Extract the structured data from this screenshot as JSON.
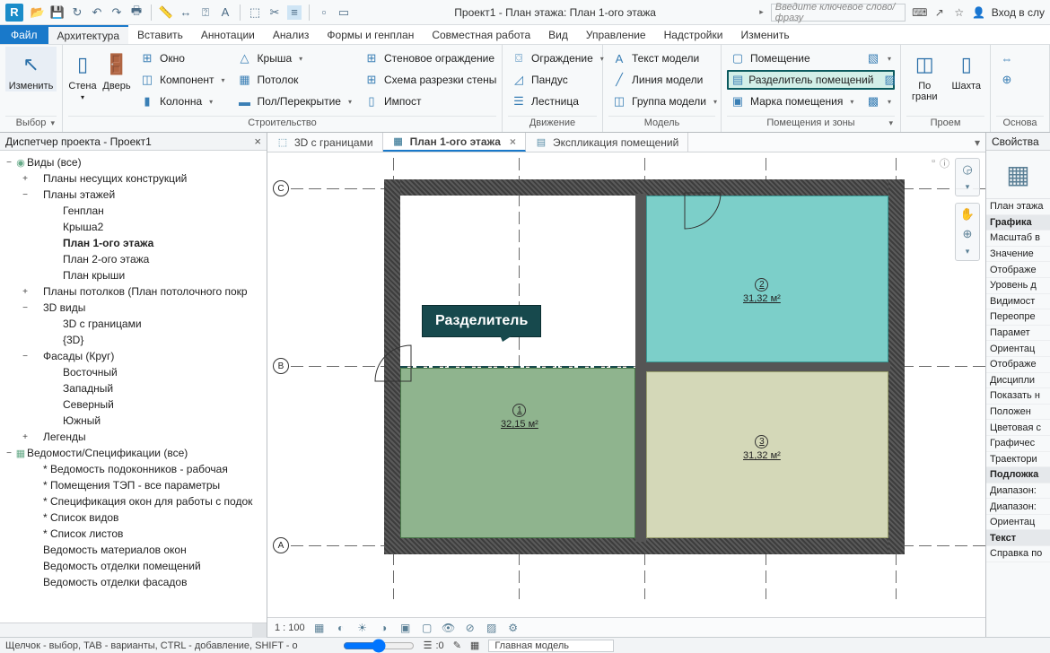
{
  "app_icon": "R",
  "title": "Проект1 - План этажа: План 1-ого этажа",
  "search_placeholder": "Введите ключевое слово/фразу",
  "signin": "Вход в слу",
  "file_tab": "Файл",
  "tabs": [
    "Архитектура",
    "Вставить",
    "Аннотации",
    "Анализ",
    "Формы и генплан",
    "Совместная работа",
    "Вид",
    "Управление",
    "Надстройки",
    "Изменить"
  ],
  "ribbon": {
    "select": {
      "big": "Изменить",
      "label": "Выбор"
    },
    "build": {
      "wall": "Стена",
      "door": "Дверь",
      "col1": [
        "Окно",
        "Компонент",
        "Колонна"
      ],
      "col2": [
        "Крыша",
        "Потолок",
        "Пол/Перекрытие"
      ],
      "col3": [
        "Стеновое ограждение",
        "Схема разрезки стены",
        "Импост"
      ],
      "label": "Строительство"
    },
    "circ": {
      "items": [
        "Ограждение",
        "Пандус",
        "Лестница"
      ],
      "label": "Движение"
    },
    "model": {
      "items": [
        "Текст модели",
        "Линия  модели",
        "Группа модели"
      ],
      "label": "Модель"
    },
    "room": {
      "items": [
        "Помещение",
        "Разделитель помещений",
        "Марка помещения"
      ],
      "label": "Помещения и зоны"
    },
    "opening": {
      "big1": "По грани",
      "big2": "Шахта",
      "label": "Проем"
    },
    "datum": {
      "label": "Основа"
    }
  },
  "browser": {
    "title": "Диспетчер проекта - Проект1",
    "nodes": [
      {
        "lvl": 0,
        "exp": "−",
        "icon": "◉",
        "label": "Виды (все)"
      },
      {
        "lvl": 1,
        "exp": "+",
        "label": "Планы несущих конструкций"
      },
      {
        "lvl": 1,
        "exp": "−",
        "label": "Планы этажей"
      },
      {
        "lvl": 2,
        "label": "Генплан"
      },
      {
        "lvl": 2,
        "label": "Крыша2"
      },
      {
        "lvl": 2,
        "label": "План 1-ого этажа",
        "bold": true
      },
      {
        "lvl": 2,
        "label": "План 2-ого этажа"
      },
      {
        "lvl": 2,
        "label": "План крыши"
      },
      {
        "lvl": 1,
        "exp": "+",
        "label": "Планы потолков (План потолочного покр"
      },
      {
        "lvl": 1,
        "exp": "−",
        "label": "3D виды"
      },
      {
        "lvl": 2,
        "label": "3D с границами"
      },
      {
        "lvl": 2,
        "label": "{3D}"
      },
      {
        "lvl": 1,
        "exp": "−",
        "label": "Фасады (Круг)"
      },
      {
        "lvl": 2,
        "label": "Восточный"
      },
      {
        "lvl": 2,
        "label": "Западный"
      },
      {
        "lvl": 2,
        "label": "Северный"
      },
      {
        "lvl": 2,
        "label": "Южный"
      },
      {
        "lvl": 1,
        "exp": "+",
        "label": "Легенды"
      },
      {
        "lvl": 0,
        "exp": "−",
        "icon": "▦",
        "label": "Ведомости/Спецификации (все)"
      },
      {
        "lvl": 1,
        "label": "* Ведомость подоконников - рабочая"
      },
      {
        "lvl": 1,
        "label": "* Помещения ТЭП - все параметры"
      },
      {
        "lvl": 1,
        "label": "* Спецификация окон для работы с подок"
      },
      {
        "lvl": 1,
        "label": "* Список видов"
      },
      {
        "lvl": 1,
        "label": "* Список листов"
      },
      {
        "lvl": 1,
        "label": "Ведомость материалов окон"
      },
      {
        "lvl": 1,
        "label": "Ведомость отделки помещений"
      },
      {
        "lvl": 1,
        "label": "Ведомость отделки фасадов"
      }
    ]
  },
  "viewtabs": [
    {
      "icon": "⬚",
      "label": "3D с границами"
    },
    {
      "icon": "▦",
      "label": "План 1-ого этажа",
      "active": true,
      "close": true
    },
    {
      "icon": "▤",
      "label": "Экспликация помещений"
    }
  ],
  "rooms": {
    "r1": {
      "num": "1",
      "area": "32,15 м²"
    },
    "r2": {
      "num": "2",
      "area": "31,32 м²"
    },
    "r3": {
      "num": "3",
      "area": "31,32 м²"
    }
  },
  "grids": {
    "h": [
      "C",
      "B",
      "A"
    ],
    "v": []
  },
  "callout": "Разделитель",
  "viewbar_scale": "1 : 100",
  "props": {
    "title": "Свойства",
    "type": "План этажа",
    "sections": [
      {
        "name": "Графика",
        "rows": [
          "Масштаб в",
          "Значение",
          "Отображе",
          "Уровень д",
          "Видимост",
          "Переопре",
          "Парамет",
          "Ориентац",
          "Отображе",
          "Дисципли",
          "Показать н",
          "Положен",
          "Цветовая с",
          "Графичес",
          "Траектори"
        ]
      },
      {
        "name": "Подложка",
        "rows": [
          "Диапазон:",
          "Диапазон:",
          "Ориентац"
        ]
      },
      {
        "name": "Текст",
        "rows": [
          "Справка по"
        ]
      }
    ]
  },
  "status": {
    "hint": "Щелчок - выбор, TAB - варианты, CTRL - добавление, SHIFT - о",
    "count": ":0",
    "model": "Главная модель"
  }
}
